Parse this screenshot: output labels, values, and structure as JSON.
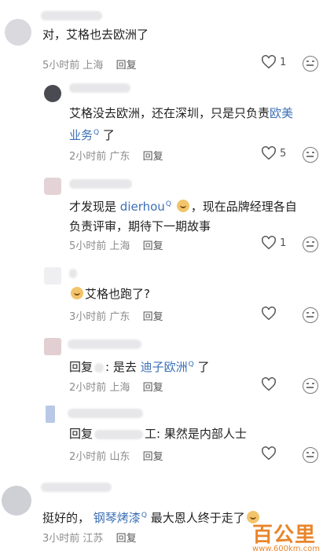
{
  "comments": [
    {
      "text": "对，艾格也去欧洲了",
      "time": "5小时前",
      "location": "上海",
      "reply": "回复",
      "likes": "1"
    },
    {
      "text_a": "艾格没去欧洲，还在深圳，只是只负责",
      "link": "欧美业务",
      "text_b": "了",
      "time": "2小时前",
      "location": "广东",
      "reply": "回复",
      "likes": "5"
    },
    {
      "text_a": "才发现是",
      "link": "dierhou",
      "text_b": "，现在品牌经理各自负责评审，期待下一期故事",
      "time": "5小时前",
      "location": "上海",
      "reply": "回复",
      "likes": "1"
    },
    {
      "text": "艾格也跑了?",
      "time": "3小时前",
      "location": "广东",
      "reply": "回复",
      "likes": ""
    },
    {
      "text_a": "回复",
      "text_b": ": 是去",
      "link": "迪子欧洲",
      "text_c": "了",
      "time": "2小时前",
      "location": "上海",
      "reply": "回复",
      "likes": ""
    },
    {
      "text_a": "回复",
      "text_b": "工: 果然是内部人士",
      "time": "2小时前",
      "location": "山东",
      "reply": "回复",
      "likes": ""
    },
    {
      "text_a": "挺好的，",
      "link": "钢琴烤漆",
      "text_b": "最大恩人终于走了",
      "time": "3小时前",
      "location": "江苏",
      "reply": "回复",
      "likes": ""
    }
  ],
  "watermark": {
    "logo": "百公里",
    "url": "www.600km.com"
  },
  "colors": {
    "link": "#3b6fb6",
    "meta": "#8c8c8c"
  }
}
